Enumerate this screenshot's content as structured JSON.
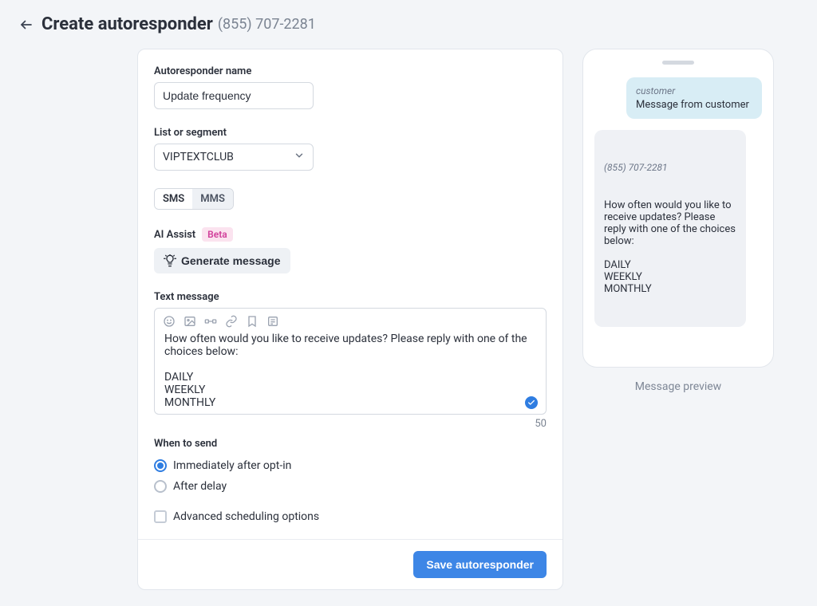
{
  "header": {
    "title": "Create autoresponder",
    "phone": "(855) 707-2281"
  },
  "form": {
    "name_label": "Autoresponder name",
    "name_value": "Update frequency",
    "list_label": "List or segment",
    "list_value": "VIPTEXTCLUB",
    "type_sms": "SMS",
    "type_mms": "MMS",
    "ai_label": "AI Assist",
    "beta_label": "Beta",
    "generate_label": "Generate message",
    "textmsg_label": "Text message",
    "textmsg_value": "How often would you like to receive updates? Please reply with one of the choices below:\n\nDAILY\nWEEKLY\nMONTHLY",
    "char_count": "50",
    "when_label": "When to send",
    "opt_immediate": "Immediately after opt-in",
    "opt_delay": "After delay",
    "adv_label": "Advanced scheduling options",
    "save_label": "Save autoresponder"
  },
  "preview": {
    "customer_label": "customer",
    "customer_msg": "Message from customer",
    "reply_from": "(855) 707-2281",
    "reply_msg": "How often would you like to receive updates? Please reply with one of the choices below:\n\nDAILY\nWEEKLY\nMONTHLY",
    "caption": "Message preview"
  }
}
